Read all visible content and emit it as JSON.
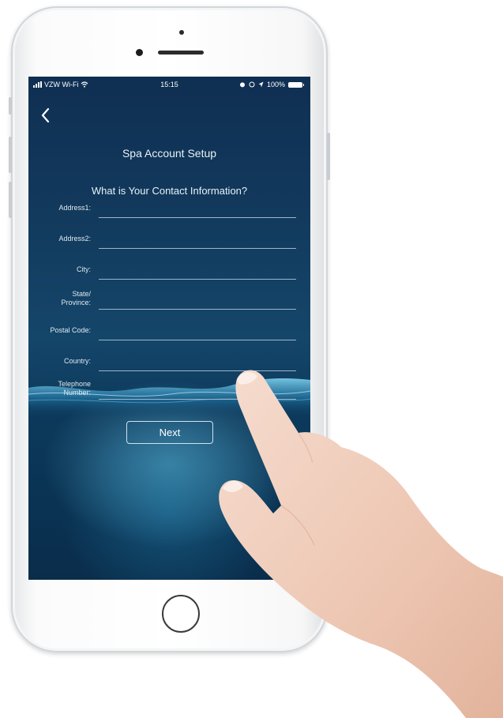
{
  "status_bar": {
    "carrier": "VZW Wi-Fi",
    "time": "15:15",
    "battery": "100%"
  },
  "header": {
    "title": "Spa Account Setup",
    "subtitle": "What is Your Contact Information?"
  },
  "form": {
    "fields": [
      {
        "label": "Address1:",
        "value": ""
      },
      {
        "label": "Address2:",
        "value": ""
      },
      {
        "label": "City:",
        "value": ""
      },
      {
        "label_line1": "State/",
        "label_line2": "Province:",
        "value": ""
      },
      {
        "label": "Postal Code:",
        "value": ""
      },
      {
        "label": "Country:",
        "value": ""
      },
      {
        "label_line1": "Telephone",
        "label_line2": "Number:",
        "value": ""
      }
    ]
  },
  "actions": {
    "next_label": "Next"
  },
  "colors": {
    "screen_top": "#0f2f52",
    "screen_bottom": "#0a2d4b",
    "accent_water": "#78d2f0"
  }
}
